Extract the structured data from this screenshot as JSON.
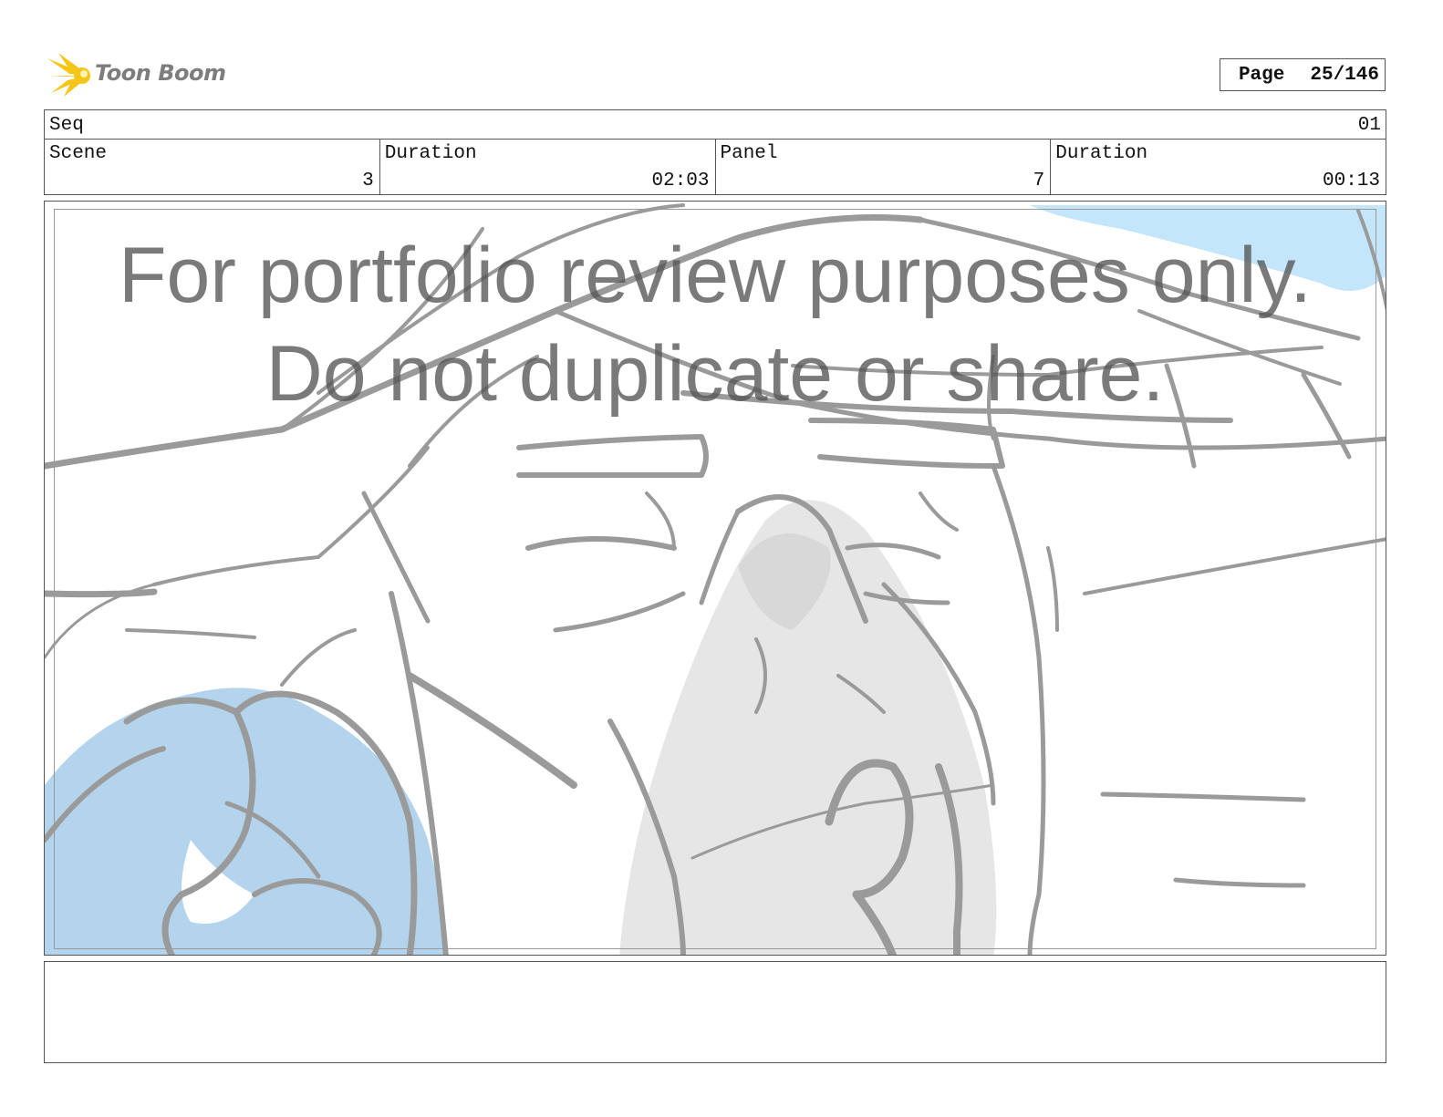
{
  "logo": {
    "text": "Toon Boom",
    "icon": "sunburst-icon",
    "icon_color": "#f5c518"
  },
  "page": {
    "label": "Page",
    "value": "25/146"
  },
  "header": {
    "seq_label": "Seq",
    "seq_value": "01",
    "scene_label": "Scene",
    "scene_value": "3",
    "scene_duration_label": "Duration",
    "scene_duration_value": "02:03",
    "panel_label": "Panel",
    "panel_value": "7",
    "panel_duration_label": "Duration",
    "panel_duration_value": "00:13"
  },
  "watermark": {
    "line1": "For portfolio review purposes only.",
    "line2": "Do not duplicate or share."
  },
  "colors": {
    "sketch": "#9a9a9a",
    "hand_fill": "#b3d4ec",
    "sky_fill": "#c3e6fa",
    "face_fill": "#e6e6e6"
  },
  "notes": {
    "text": ""
  }
}
